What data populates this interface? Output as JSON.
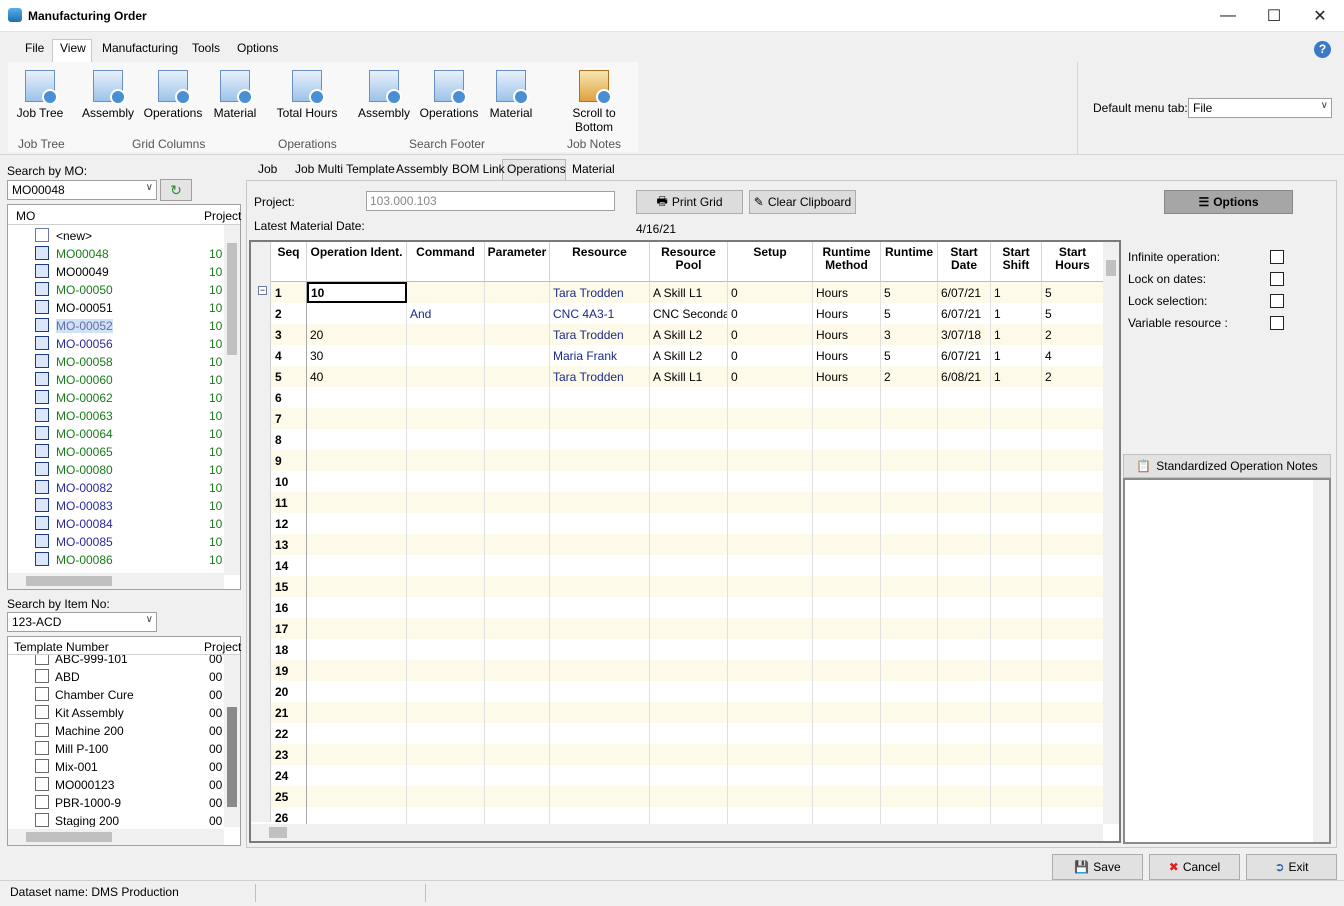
{
  "window": {
    "title": "Manufacturing Order"
  },
  "menu_tabs": [
    "File",
    "View",
    "Manufacturing",
    "Tools",
    "Options"
  ],
  "ribbon": {
    "buttons": [
      "Job Tree",
      "Assembly",
      "Operations",
      "Material",
      "Total Hours",
      "Assembly",
      "Operations",
      "Material",
      "Scroll to Bottom"
    ],
    "groups": [
      "Job Tree",
      "Grid Columns",
      "Operations",
      "Search Footer",
      "Job Notes"
    ],
    "default_menu_label": "Default menu tab:",
    "default_menu_value": "File"
  },
  "search_mo": {
    "label": "Search by MO:",
    "value": "MO00048",
    "col_mo": "MO",
    "col_project": "Project",
    "items": [
      {
        "text": "<new>",
        "project": ""
      },
      {
        "text": "MO00048",
        "project": "10"
      },
      {
        "text": "MO00049",
        "project": "10"
      },
      {
        "text": "MO-00050",
        "project": "10"
      },
      {
        "text": "MO-00051",
        "project": "10"
      },
      {
        "text": "MO-00052",
        "project": "10"
      },
      {
        "text": "MO-00056",
        "project": "10"
      },
      {
        "text": "MO-00058",
        "project": "10"
      },
      {
        "text": "MO-00060",
        "project": "10"
      },
      {
        "text": "MO-00062",
        "project": "10"
      },
      {
        "text": "MO-00063",
        "project": "10"
      },
      {
        "text": "MO-00064",
        "project": "10"
      },
      {
        "text": "MO-00065",
        "project": "10"
      },
      {
        "text": "MO-00080",
        "project": "10"
      },
      {
        "text": "MO-00082",
        "project": "10"
      },
      {
        "text": "MO-00083",
        "project": "10"
      },
      {
        "text": "MO-00084",
        "project": "10"
      },
      {
        "text": "MO-00085",
        "project": "10"
      },
      {
        "text": "MO-00086",
        "project": "10"
      }
    ]
  },
  "search_item": {
    "label": "Search by Item No:",
    "value": "123-ACD",
    "col_template": "Template Number",
    "col_project": "Project",
    "items": [
      {
        "text": "ABC-999-101",
        "project": "00"
      },
      {
        "text": "ABD",
        "project": "00"
      },
      {
        "text": "Chamber Cure",
        "project": "00"
      },
      {
        "text": "Kit Assembly",
        "project": "00"
      },
      {
        "text": "Machine 200",
        "project": "00"
      },
      {
        "text": "Mill P-100",
        "project": "00"
      },
      {
        "text": "Mix-001",
        "project": "00"
      },
      {
        "text": "MO000123",
        "project": "00"
      },
      {
        "text": "PBR-1000-9",
        "project": "00"
      },
      {
        "text": "Staging 200",
        "project": "00"
      }
    ]
  },
  "content_tabs": [
    "Job",
    "Job Multi Template",
    "Assembly",
    "BOM Link",
    "Operations",
    "Material"
  ],
  "form": {
    "project_label": "Project:",
    "project_value": "103.000.103",
    "latest_material_label": "Latest Material Date:",
    "latest_material_value": "4/16/21",
    "print_grid": "Print Grid",
    "clear_clipboard": "Clear Clipboard",
    "options": "Options"
  },
  "grid": {
    "columns": [
      "Seq",
      "Operation Ident.",
      "Command",
      "Parameter",
      "Resource",
      "Resource Pool",
      "Setup",
      "Runtime Method",
      "Runtime",
      "Start Date",
      "Start Shift",
      "Start Hours"
    ],
    "rows": [
      {
        "seq": "1",
        "op": "10",
        "cmd": "",
        "param": "",
        "res": "Tara Trodden",
        "pool": "A Skill L1",
        "setup": "0",
        "method": "Hours",
        "runtime": "5",
        "date": "6/07/21",
        "shift": "1",
        "hours": "5"
      },
      {
        "seq": "2",
        "op": "",
        "cmd": "And",
        "param": "",
        "res": "CNC 4A3-1",
        "pool": "CNC Secondary",
        "setup": "0",
        "method": "Hours",
        "runtime": "5",
        "date": "6/07/21",
        "shift": "1",
        "hours": "5"
      },
      {
        "seq": "3",
        "op": "20",
        "cmd": "",
        "param": "",
        "res": "Tara Trodden",
        "pool": "A Skill L2",
        "setup": "0",
        "method": "Hours",
        "runtime": "3",
        "date": "3/07/18",
        "shift": "1",
        "hours": "2"
      },
      {
        "seq": "4",
        "op": "30",
        "cmd": "",
        "param": "",
        "res": "Maria Frank",
        "pool": "A Skill L2",
        "setup": "0",
        "method": "Hours",
        "runtime": "5",
        "date": "6/07/21",
        "shift": "1",
        "hours": "4"
      },
      {
        "seq": "5",
        "op": "40",
        "cmd": "",
        "param": "",
        "res": "Tara Trodden",
        "pool": "A Skill L1",
        "setup": "0",
        "method": "Hours",
        "runtime": "2",
        "date": "6/08/21",
        "shift": "1",
        "hours": "2"
      }
    ],
    "empty_seqs": [
      "6",
      "7",
      "8",
      "9",
      "10",
      "11",
      "12",
      "13",
      "14",
      "15",
      "16",
      "17",
      "18",
      "19",
      "20",
      "21",
      "22",
      "23",
      "24",
      "25",
      "26"
    ]
  },
  "options_panel": {
    "items": [
      "Infinite operation:",
      "Lock on dates:",
      "Lock selection:",
      "Variable resource :"
    ],
    "notes_label": "Standardized Operation Notes"
  },
  "footer": {
    "save": "Save",
    "cancel": "Cancel",
    "exit": "Exit"
  },
  "status": {
    "dataset": "Dataset name:  DMS Production"
  }
}
